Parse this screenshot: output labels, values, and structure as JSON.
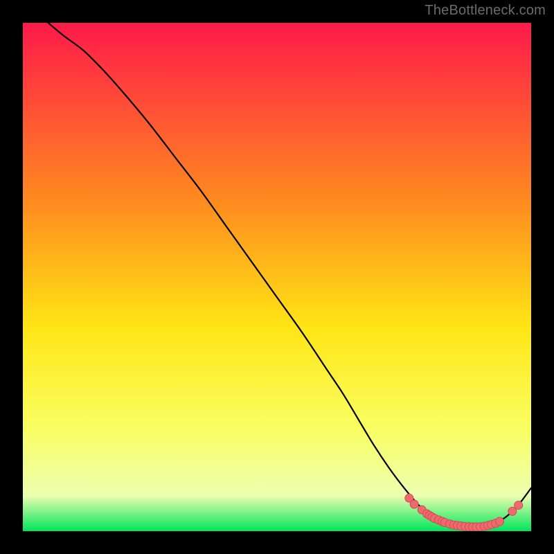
{
  "watermark": "TheBottleneck.com",
  "colors": {
    "background": "#000000",
    "gradient_top": "#ff1a4a",
    "gradient_upper_mid": "#ff8a1f",
    "gradient_mid": "#ffe615",
    "gradient_lower_mid": "#f9ff63",
    "gradient_low": "#ecffb0",
    "gradient_bottom": "#00e55a",
    "curve": "#000000",
    "points_fill": "#ef6a6f",
    "points_stroke": "#d24a52"
  },
  "chart_data": {
    "type": "line",
    "title": "",
    "xlabel": "",
    "ylabel": "",
    "xlim": [
      0,
      100
    ],
    "ylim": [
      0,
      100
    ],
    "curve": {
      "x": [
        5,
        8,
        12,
        16,
        20,
        25,
        30,
        35,
        40,
        45,
        50,
        55,
        60,
        63,
        66,
        69,
        72,
        75,
        78,
        80,
        82,
        84,
        86,
        88,
        90,
        92,
        94,
        96,
        98,
        100
      ],
      "y": [
        100,
        97.5,
        94.5,
        90.5,
        86,
        80,
        73.5,
        67,
        60,
        53,
        46,
        39,
        31.5,
        27,
        22,
        17,
        12.5,
        8.5,
        5,
        3.3,
        2.1,
        1.4,
        1.0,
        0.8,
        0.9,
        1.3,
        2.1,
        3.6,
        5.8,
        8.5
      ]
    },
    "series": [
      {
        "name": "highlight-points-cluster",
        "x": [
          76.0,
          77.0,
          78.5,
          79.5,
          80.0,
          80.5,
          81.0,
          81.8,
          82.5,
          83.0
        ],
        "y": [
          6.5,
          5.3,
          4.2,
          3.4,
          3.1,
          2.8,
          2.5,
          2.2,
          1.9,
          1.7
        ]
      },
      {
        "name": "highlight-points-trough",
        "x": [
          84.0,
          84.8,
          85.5,
          86.2,
          87.0,
          87.8,
          88.5,
          89.2,
          90.0,
          90.8,
          91.5,
          92.2,
          93.0,
          93.8
        ],
        "y": [
          1.4,
          1.2,
          1.1,
          1.0,
          0.9,
          0.85,
          0.82,
          0.82,
          0.86,
          0.95,
          1.1,
          1.3,
          1.55,
          1.9
        ]
      },
      {
        "name": "highlight-points-rise",
        "x": [
          96.3,
          97.5
        ],
        "y": [
          3.9,
          5.1
        ]
      }
    ]
  }
}
